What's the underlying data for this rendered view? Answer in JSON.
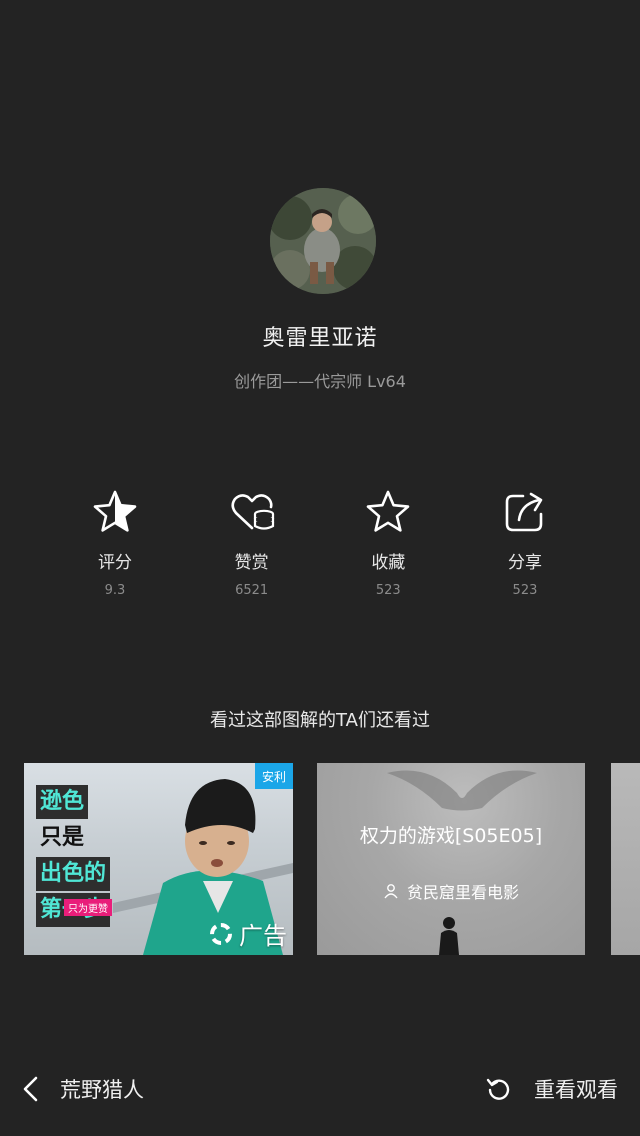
{
  "profile": {
    "name": "奥雷里亚诺",
    "subtitle": "创作团——代宗师 Lv64"
  },
  "actions": [
    {
      "label": "评分",
      "value": "9.3",
      "icon": "star-filled-icon"
    },
    {
      "label": "赞赏",
      "value": "6521",
      "icon": "heart-coins-icon"
    },
    {
      "label": "收藏",
      "value": "523",
      "icon": "star-outline-icon"
    },
    {
      "label": "分享",
      "value": "523",
      "icon": "share-icon"
    }
  ],
  "recommendations": {
    "title": "看过这部图解的TA们还看过",
    "ad_card": {
      "tag": "安利",
      "headline": [
        "逊色",
        "只是",
        "出色的",
        "第一步"
      ],
      "small_text": "只为更赞",
      "badge": "广告"
    },
    "cards": [
      {
        "title": "权力的游戏[S05E05]",
        "author": "贫民窟里看电影"
      }
    ]
  },
  "bottom_bar": {
    "back_title": "荒野猎人",
    "replay_label": "重看观看"
  },
  "colors": {
    "background": "#232323",
    "ad_tag": "#1ba6e8",
    "accent_text": "#50e7d6"
  }
}
